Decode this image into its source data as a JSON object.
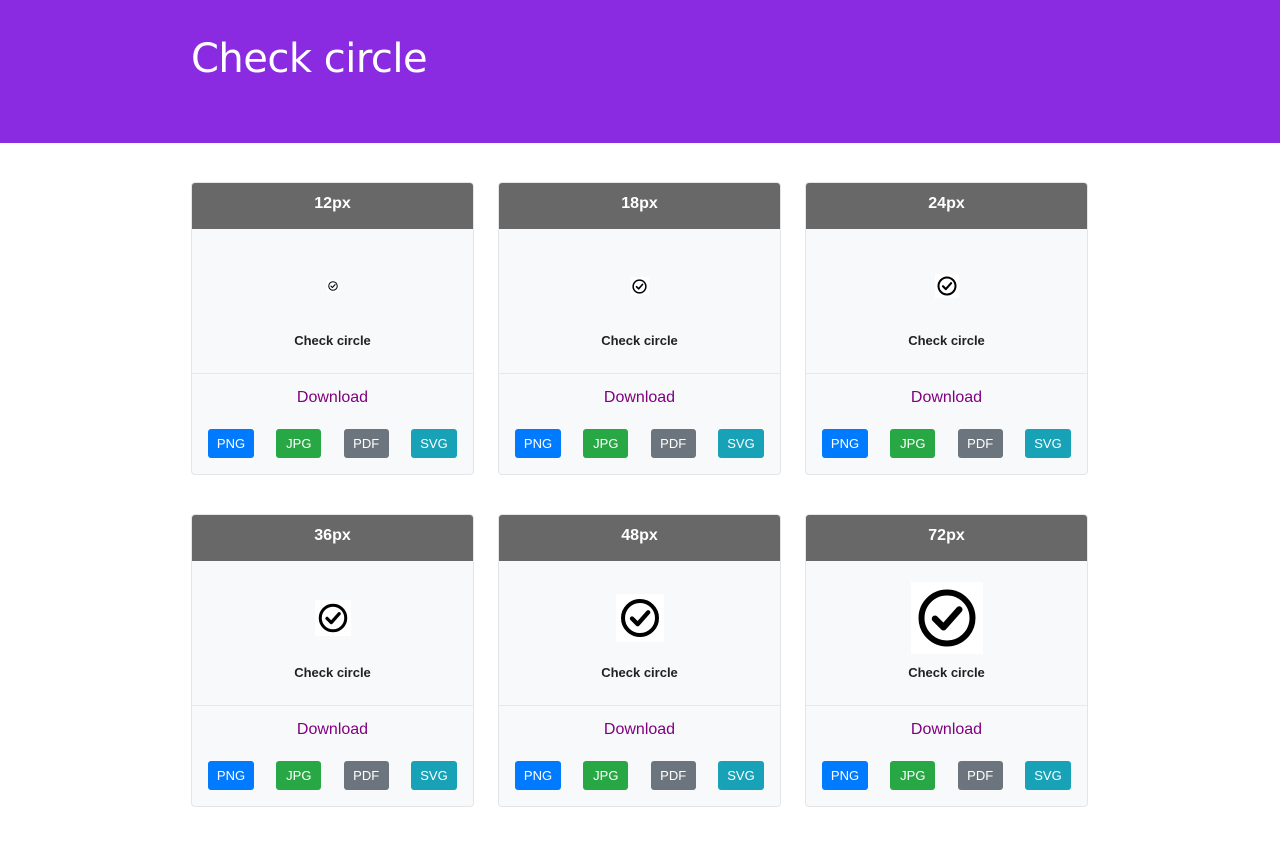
{
  "page": {
    "title": "Check circle"
  },
  "colors": {
    "hero_bg": "#8a2be2",
    "header_bg": "#686868",
    "download_link": "#800080",
    "png": "#007bff",
    "jpg": "#28a745",
    "pdf": "#6c757d",
    "svg": "#17a2b8"
  },
  "cards": [
    {
      "size_label": "12px",
      "size": 12,
      "icon": "check-circle-icon",
      "name": "Check circle",
      "download_label": "Download",
      "buttons": {
        "png": "PNG",
        "jpg": "JPG",
        "pdf": "PDF",
        "svg": "SVG"
      }
    },
    {
      "size_label": "18px",
      "size": 18,
      "icon": "check-circle-icon",
      "name": "Check circle",
      "download_label": "Download",
      "buttons": {
        "png": "PNG",
        "jpg": "JPG",
        "pdf": "PDF",
        "svg": "SVG"
      }
    },
    {
      "size_label": "24px",
      "size": 24,
      "icon": "check-circle-icon",
      "name": "Check circle",
      "download_label": "Download",
      "buttons": {
        "png": "PNG",
        "jpg": "JPG",
        "pdf": "PDF",
        "svg": "SVG"
      }
    },
    {
      "size_label": "36px",
      "size": 36,
      "icon": "check-circle-icon",
      "name": "Check circle",
      "download_label": "Download",
      "buttons": {
        "png": "PNG",
        "jpg": "JPG",
        "pdf": "PDF",
        "svg": "SVG"
      }
    },
    {
      "size_label": "48px",
      "size": 48,
      "icon": "check-circle-icon",
      "name": "Check circle",
      "download_label": "Download",
      "buttons": {
        "png": "PNG",
        "jpg": "JPG",
        "pdf": "PDF",
        "svg": "SVG"
      }
    },
    {
      "size_label": "72px",
      "size": 72,
      "icon": "check-circle-icon",
      "name": "Check circle",
      "download_label": "Download",
      "buttons": {
        "png": "PNG",
        "jpg": "JPG",
        "pdf": "PDF",
        "svg": "SVG"
      }
    }
  ]
}
